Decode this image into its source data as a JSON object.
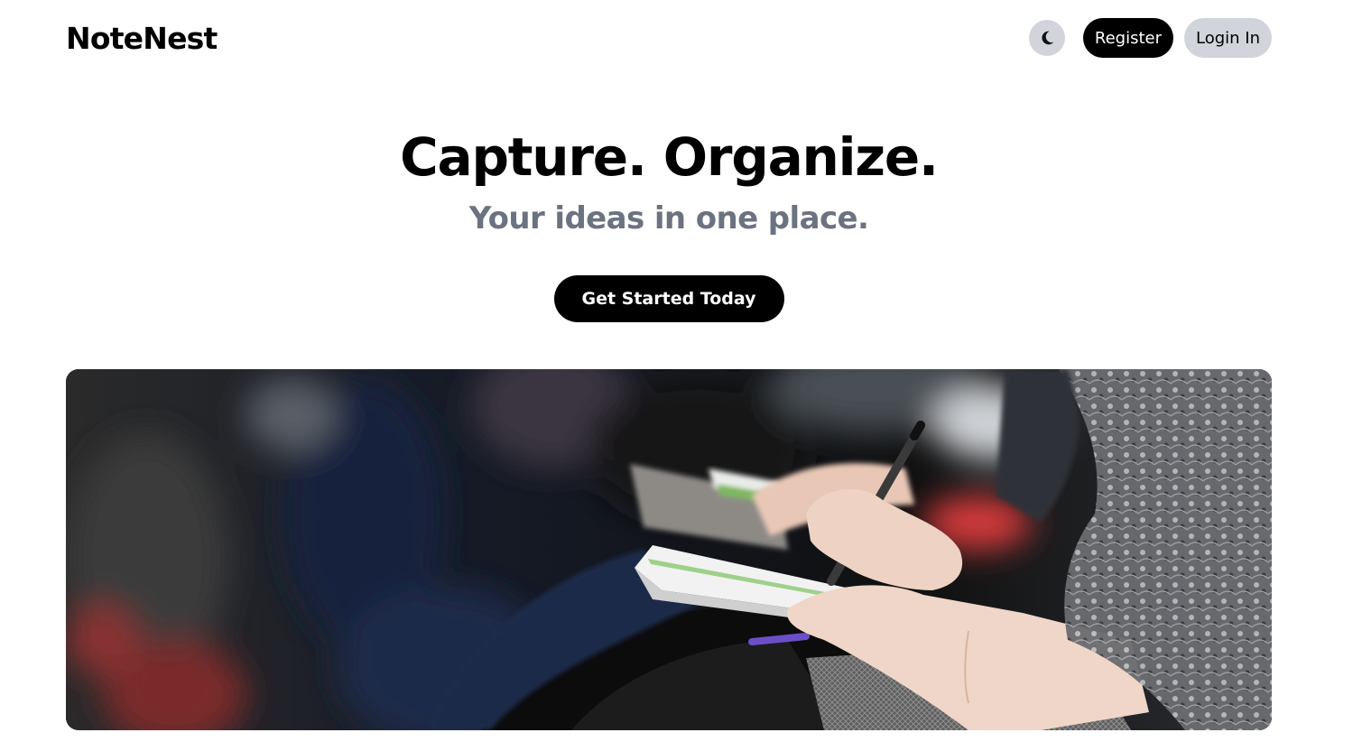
{
  "header": {
    "brand": "NoteNest",
    "theme_toggle_icon": "moon-icon",
    "register_label": "Register",
    "login_label": "Login In"
  },
  "hero": {
    "title": "Capture. Organize.",
    "subtitle": "Your ideas in one place.",
    "cta_label": "Get Started Today",
    "image_subject": "people-writing-in-notebooks-photo"
  },
  "colors": {
    "primary": "#000000",
    "secondary_button": "#d1d5db",
    "muted_text": "#6b7280",
    "background": "#ffffff"
  }
}
